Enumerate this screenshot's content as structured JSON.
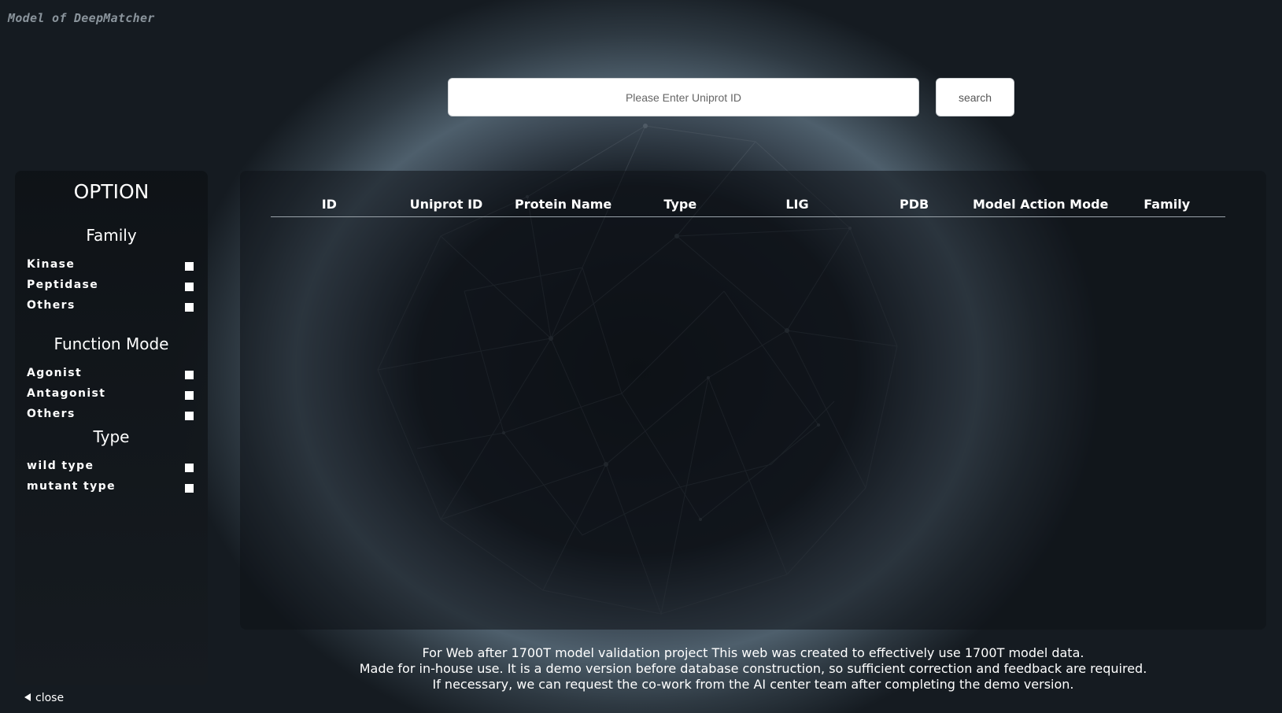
{
  "app_title": "Model of DeepMatcher",
  "search": {
    "placeholder": "Please Enter Uniprot ID",
    "value": "",
    "button_label": "search"
  },
  "sidebar": {
    "title": "OPTION",
    "sections": [
      {
        "title": "Family",
        "options": [
          "Kinase",
          "Peptidase",
          "Others"
        ]
      },
      {
        "title": "Function Mode",
        "options": [
          "Agonist",
          "Antagonist",
          "Others"
        ]
      },
      {
        "title": "Type",
        "options": [
          "wild type",
          "mutant type"
        ]
      }
    ],
    "close_label": "close"
  },
  "table": {
    "columns": [
      "ID",
      "Uniprot ID",
      "Protein Name",
      "Type",
      "LIG",
      "PDB",
      "Model Action Mode",
      "Family"
    ],
    "rows": []
  },
  "footer": {
    "lines": [
      "For Web after 1700T model validation project This web was created to effectively use 1700T model data.",
      "Made for in-house use. It is a demo version before database construction, so sufficient correction and feedback are required.",
      "If necessary, we can request the co-work from the AI center team after completing the demo version."
    ]
  },
  "colors": {
    "background_dark": "#12171c",
    "panel": "#161b20",
    "text": "#ffffff",
    "title_gray": "#8a949c"
  }
}
